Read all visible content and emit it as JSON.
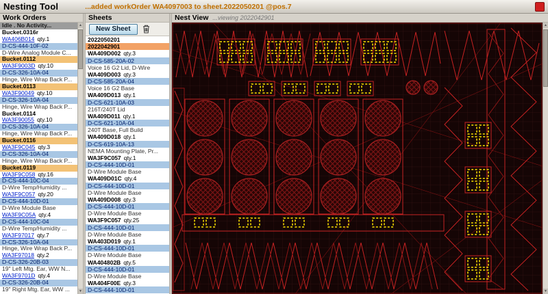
{
  "header": {
    "app_title": "Nesting Tool",
    "status_text": "...added workOrder WA4097003 to sheet.2022050201 @pos.7"
  },
  "icons": {
    "scroll_up": "▲",
    "scroll_down": "▼"
  },
  "work_orders": {
    "title": "Work Orders",
    "items": [
      {
        "type": "idle",
        "text": "Idle . No Activity..."
      },
      {
        "type": "bucket",
        "text": "Bucket.0316r"
      },
      {
        "type": "wo",
        "id": "WA406B014",
        "qty": "qty.1"
      },
      {
        "type": "part",
        "text": "D-CS-444-10F-02"
      },
      {
        "type": "desc",
        "text": "D-Wire Analog Module C..."
      },
      {
        "type": "bucket",
        "text": "Bucket.0112",
        "hl": true
      },
      {
        "type": "wo",
        "id": "WA3F9003D",
        "qty": "qty.10"
      },
      {
        "type": "part",
        "text": "D-CS-326-10A-04"
      },
      {
        "type": "desc",
        "text": "Hinge, Wire Wrap Back P..."
      },
      {
        "type": "bucket",
        "text": "Bucket.0113",
        "hl": true
      },
      {
        "type": "wo",
        "id": "WA3F90049",
        "qty": "qty.10"
      },
      {
        "type": "part",
        "text": "D-CS-326-10A-04"
      },
      {
        "type": "desc",
        "text": "Hinge, Wire Wrap Back P..."
      },
      {
        "type": "bucket",
        "text": "Bucket.0114"
      },
      {
        "type": "wo",
        "id": "WA3F90055",
        "qty": "qty.10"
      },
      {
        "type": "part",
        "text": "D-CS-326-10A-04"
      },
      {
        "type": "desc",
        "text": "Hinge, Wire Wrap Back P..."
      },
      {
        "type": "bucket",
        "text": "Bucket.0116",
        "hl": true
      },
      {
        "type": "wo",
        "id": "WA3F9C045",
        "qty": "qty.3"
      },
      {
        "type": "part",
        "text": "D-CS-326-10A-04"
      },
      {
        "type": "desc",
        "text": "Hinge, Wire Wrap Back P..."
      },
      {
        "type": "bucket",
        "text": "Bucket.0119",
        "hl": true
      },
      {
        "type": "wo",
        "id": "WA3F9C058",
        "qty": "qty.16"
      },
      {
        "type": "part",
        "text": "D-CS-444-10C-04"
      },
      {
        "type": "desc",
        "text": "D-Wire Temp/Humidity ..."
      },
      {
        "type": "wo",
        "id": "WA3F9C057",
        "qty": "qty.20"
      },
      {
        "type": "part",
        "text": "D-CS-444-10D-01"
      },
      {
        "type": "desc",
        "text": "D-Wire Module Base"
      },
      {
        "type": "wo",
        "id": "WA3F9C05A",
        "qty": "qty.4"
      },
      {
        "type": "part",
        "text": "D-CS-444-10C-04"
      },
      {
        "type": "desc",
        "text": "D-Wire Temp/Humidity ..."
      },
      {
        "type": "wo",
        "id": "WA3F97017",
        "qty": "qty.7"
      },
      {
        "type": "part",
        "text": "D-CS-326-10A-04"
      },
      {
        "type": "desc",
        "text": "Hinge, Wire Wrap Back P..."
      },
      {
        "type": "wo",
        "id": "WA3F97018",
        "qty": "qty.2"
      },
      {
        "type": "part",
        "text": "D-CS-326-20B-03"
      },
      {
        "type": "desc",
        "text": "19\" Left Mtg. Ear, WW N..."
      },
      {
        "type": "wo",
        "id": "WA3F9701D",
        "qty": "qty.4"
      },
      {
        "type": "part",
        "text": "D-CS-326-20B-04"
      },
      {
        "type": "desc",
        "text": "19\" Right Mtg. Ear, WW ..."
      }
    ]
  },
  "sheets": {
    "title": "Sheets",
    "new_sheet_label": "New Sheet",
    "items": [
      {
        "type": "tab",
        "text": "2022050201"
      },
      {
        "type": "tab",
        "text": "2022042901",
        "selected": true
      },
      {
        "type": "wo",
        "id": "WA409D002",
        "qty": "qty.3"
      },
      {
        "type": "part",
        "text": "D-CS-585-20A-02"
      },
      {
        "type": "desc",
        "text": "Voice 16 G2 Lid, D-Wire"
      },
      {
        "type": "wo",
        "id": "WA409D003",
        "qty": "qty.3"
      },
      {
        "type": "part",
        "text": "D-CS-585-20A-04"
      },
      {
        "type": "desc",
        "text": "Voice 16 G2 Base"
      },
      {
        "type": "wo",
        "id": "WA409D013",
        "qty": "qty.1"
      },
      {
        "type": "part",
        "text": "D-CS-621-10A-03"
      },
      {
        "type": "desc",
        "text": "216T/240T Lid"
      },
      {
        "type": "wo",
        "id": "WA409D011",
        "qty": "qty.1"
      },
      {
        "type": "part",
        "text": "D-CS-621-10A-04"
      },
      {
        "type": "desc",
        "text": "240T Base, Full Build"
      },
      {
        "type": "wo",
        "id": "WA409D018",
        "qty": "qty.1"
      },
      {
        "type": "part",
        "text": "D-CS-619-10A-13"
      },
      {
        "type": "desc",
        "text": "NEMA Mounting Plate, Pr..."
      },
      {
        "type": "wo",
        "id": "WA3F9C057",
        "qty": "qty.1"
      },
      {
        "type": "part",
        "text": "D-CS-444-10D-01"
      },
      {
        "type": "desc",
        "text": "D-Wire Module Base"
      },
      {
        "type": "wo",
        "id": "WA409D01C",
        "qty": "qty.4"
      },
      {
        "type": "part",
        "text": "D-CS-444-10D-01"
      },
      {
        "type": "desc",
        "text": "D-Wire Module Base"
      },
      {
        "type": "wo",
        "id": "WA409D008",
        "qty": "qty.3"
      },
      {
        "type": "part",
        "text": "D-CS-444-10D-01"
      },
      {
        "type": "desc",
        "text": "D-Wire Module Base"
      },
      {
        "type": "wo",
        "id": "WA3F9C057",
        "qty": "qty.25"
      },
      {
        "type": "part",
        "text": "D-CS-444-10D-01"
      },
      {
        "type": "desc",
        "text": "D-Wire Module Base"
      },
      {
        "type": "wo",
        "id": "WA403D019",
        "qty": "qty.1"
      },
      {
        "type": "part",
        "text": "D-CS-444-10D-01"
      },
      {
        "type": "desc",
        "text": "D-Wire Module Base"
      },
      {
        "type": "wo",
        "id": "WA404802B",
        "qty": "qty.5"
      },
      {
        "type": "part",
        "text": "D-CS-444-10D-01"
      },
      {
        "type": "desc",
        "text": "D-Wire Module Base"
      },
      {
        "type": "wo",
        "id": "WA404F00E",
        "qty": "qty.3"
      },
      {
        "type": "part",
        "text": "D-CS-444-10D-01"
      }
    ]
  },
  "nest_view": {
    "title": "Nest View",
    "viewing_text": "...viewing 2022042901"
  }
}
